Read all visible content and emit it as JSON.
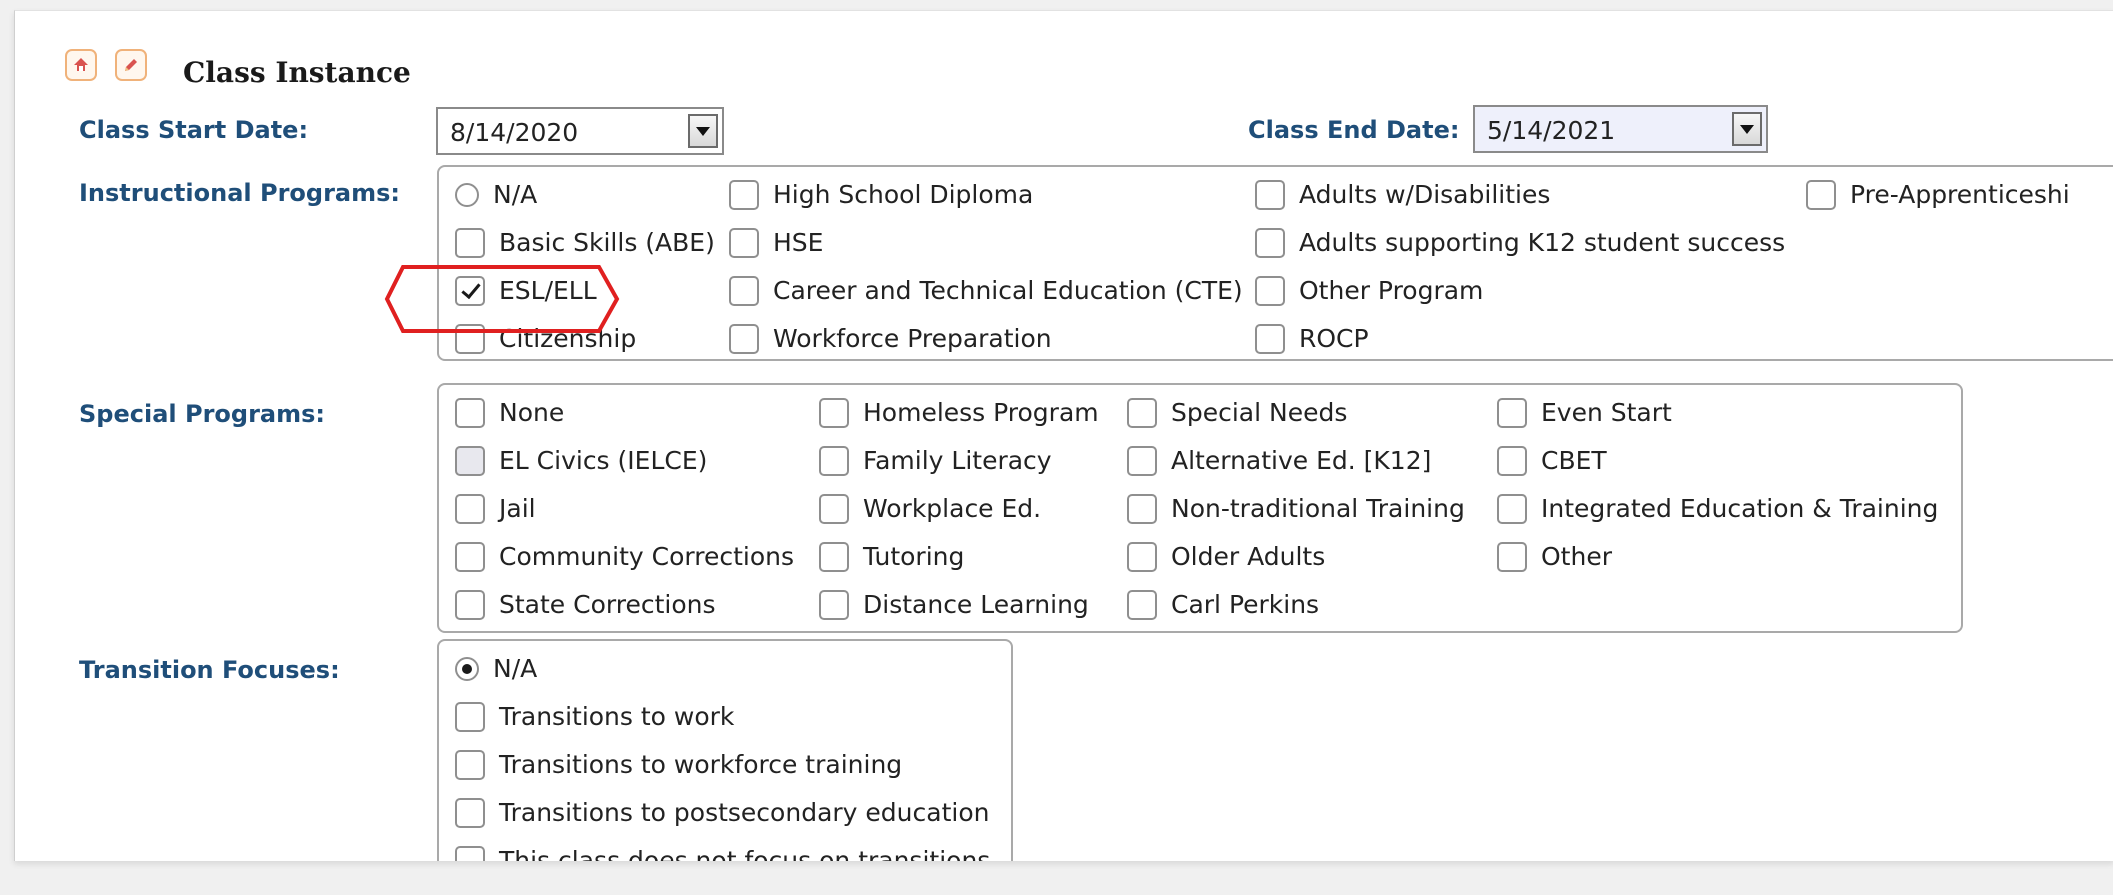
{
  "section": {
    "title": "Class Instance",
    "icons": [
      "home-up-icon",
      "edit-pencil-icon"
    ]
  },
  "class_start_date": {
    "label": "Class Start Date:",
    "value": "8/14/2020"
  },
  "class_end_date": {
    "label": "Class End Date:",
    "value": "5/14/2021"
  },
  "instructional_programs": {
    "label": "Instructional Programs:",
    "options": [
      {
        "label": "N/A",
        "type": "radio",
        "selected": false
      },
      {
        "label": "High School Diploma",
        "type": "checkbox",
        "checked": false
      },
      {
        "label": "Adults w/Disabilities",
        "type": "checkbox",
        "checked": false
      },
      {
        "label": "Pre-Apprenticeshi",
        "type": "checkbox",
        "checked": false
      },
      {
        "label": "Basic Skills (ABE)",
        "type": "checkbox",
        "checked": false
      },
      {
        "label": "HSE",
        "type": "checkbox",
        "checked": false
      },
      {
        "label": "Adults supporting K12 student success",
        "type": "checkbox",
        "checked": false
      },
      {
        "label": "ESL/ELL",
        "type": "checkbox",
        "checked": true
      },
      {
        "label": "Career and Technical Education (CTE)",
        "type": "checkbox",
        "checked": false
      },
      {
        "label": "Other Program",
        "type": "checkbox",
        "checked": false
      },
      {
        "label": "Citizenship",
        "type": "checkbox",
        "checked": false
      },
      {
        "label": "Workforce Preparation",
        "type": "checkbox",
        "checked": false
      },
      {
        "label": "ROCP",
        "type": "checkbox",
        "checked": false
      }
    ]
  },
  "special_programs": {
    "label": "Special Programs:",
    "options": [
      {
        "label": "None",
        "checked": false
      },
      {
        "label": "Homeless Program",
        "checked": false
      },
      {
        "label": "Special Needs",
        "checked": false
      },
      {
        "label": "Even Start",
        "checked": false
      },
      {
        "label": "EL Civics (IELCE)",
        "checked": false
      },
      {
        "label": "Family Literacy",
        "checked": false
      },
      {
        "label": "Alternative Ed. [K12]",
        "checked": false
      },
      {
        "label": "CBET",
        "checked": false
      },
      {
        "label": "Jail",
        "checked": false
      },
      {
        "label": "Workplace Ed.",
        "checked": false
      },
      {
        "label": "Non-traditional Training",
        "checked": false
      },
      {
        "label": "Integrated Education & Training",
        "checked": false
      },
      {
        "label": "Community Corrections",
        "checked": false
      },
      {
        "label": "Tutoring",
        "checked": false
      },
      {
        "label": "Older Adults",
        "checked": false
      },
      {
        "label": "Other",
        "checked": false
      },
      {
        "label": "State Corrections",
        "checked": false
      },
      {
        "label": "Distance Learning",
        "checked": false
      },
      {
        "label": "Carl Perkins",
        "checked": false
      }
    ]
  },
  "transition_focuses": {
    "label": "Transition Focuses:",
    "options": [
      {
        "label": "N/A",
        "type": "radio",
        "selected": true
      },
      {
        "label": "Transitions to work",
        "type": "checkbox",
        "checked": false
      },
      {
        "label": "Transitions to workforce training",
        "type": "checkbox",
        "checked": false
      },
      {
        "label": "Transitions to postsecondary education",
        "type": "checkbox",
        "checked": false
      },
      {
        "label": "This class does not focus on transitions",
        "type": "checkbox",
        "checked": false
      }
    ]
  },
  "highlight": {
    "color": "#e02020",
    "target": "ESL/ELL"
  }
}
